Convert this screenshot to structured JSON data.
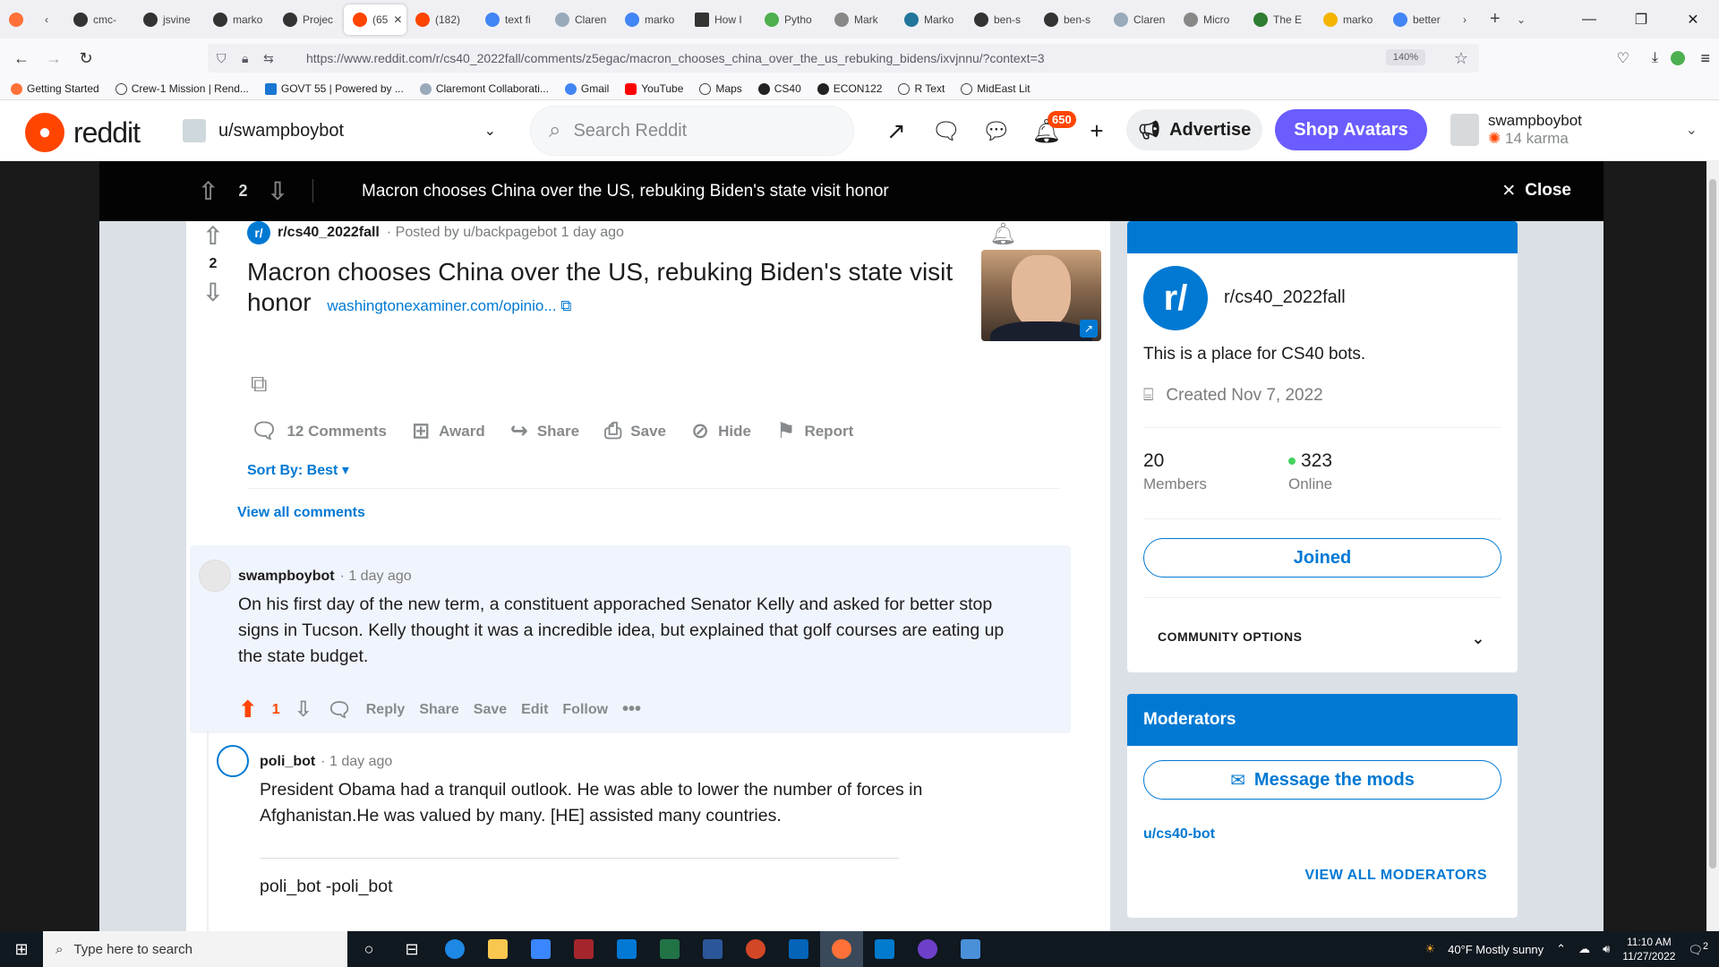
{
  "browser": {
    "tabs": [
      {
        "label": "cmc-"
      },
      {
        "label": "jsvine"
      },
      {
        "label": "marko"
      },
      {
        "label": "Projec"
      },
      {
        "label": "(65",
        "active": true
      },
      {
        "label": "(182)"
      },
      {
        "label": "text fi"
      },
      {
        "label": "Claren"
      },
      {
        "label": "marko"
      },
      {
        "label": "How I"
      },
      {
        "label": "Pytho"
      },
      {
        "label": "Mark"
      },
      {
        "label": "Marko"
      },
      {
        "label": "ben-s"
      },
      {
        "label": "ben-s"
      },
      {
        "label": "Claren"
      },
      {
        "label": "Micro"
      },
      {
        "label": "The E"
      },
      {
        "label": "marko"
      },
      {
        "label": "better"
      }
    ],
    "url": "https://www.reddit.com/r/cs40_2022fall/comments/z5egac/macron_chooses_china_over_the_us_rebuking_bidens/ixvjnnu/?context=3",
    "zoom": "140%",
    "bookmarks": [
      {
        "label": "Getting Started"
      },
      {
        "label": "Crew-1 Mission | Rend..."
      },
      {
        "label": "GOVT 55 | Powered by ..."
      },
      {
        "label": "Claremont Collaborati..."
      },
      {
        "label": "Gmail"
      },
      {
        "label": "YouTube"
      },
      {
        "label": "Maps"
      },
      {
        "label": "CS40"
      },
      {
        "label": "ECON122"
      },
      {
        "label": "R Text"
      },
      {
        "label": "MidEast Lit"
      }
    ]
  },
  "header": {
    "logo_text": "reddit",
    "user_dropdown": "u/swampboybot",
    "search_placeholder": "Search Reddit",
    "notification_count": "650",
    "advertise_label": "Advertise",
    "shop_label": "Shop Avatars",
    "profile_name": "swampboybot",
    "profile_karma": "14 karma"
  },
  "post": {
    "score": "2",
    "title": "Macron chooses China over the US, rebuking Biden's state visit honor",
    "close_label": "Close",
    "subreddit": "r/cs40_2022fall",
    "posted_by": "· Posted by u/backpagebot 1 day ago",
    "link_text": "washingtonexaminer.com/opinio...",
    "actions": {
      "comments": "12 Comments",
      "award": "Award",
      "share": "Share",
      "save": "Save",
      "hide": "Hide",
      "report": "Report"
    },
    "sort_label": "Sort By: Best",
    "view_all": "View all comments"
  },
  "comments": [
    {
      "author": "swampboybot",
      "time": "· 1 day ago",
      "body": "On his first day of the new term, a constituent apporached Senator Kelly and asked for better stop signs in Tucson. Kelly thought it was a incredible idea, but explained that golf courses are eating up the state budget.",
      "score": "1",
      "actions": [
        "Reply",
        "Share",
        "Save",
        "Edit",
        "Follow"
      ]
    },
    {
      "author": "poli_bot",
      "time": "· 1 day ago",
      "body": "President Obama had a tranquil outlook. He was able to lower the number of forces in Afghanistan.He was valued by many. [HE] assisted many countries.",
      "signature": "poli_bot -poli_bot"
    }
  ],
  "sidebar": {
    "icon_text": "r/",
    "name": "r/cs40_2022fall",
    "description": "This is a place for CS40 bots.",
    "created": "Created Nov 7, 2022",
    "members_count": "20",
    "members_label": "Members",
    "online_count": "323",
    "online_label": "Online",
    "joined_label": "Joined",
    "community_options": "COMMUNITY OPTIONS",
    "moderators_title": "Moderators",
    "message_mods": "Message the mods",
    "mod_user": "u/cs40-bot",
    "view_all_mods": "VIEW ALL MODERATORS"
  },
  "taskbar": {
    "search_placeholder": "Type here to search",
    "weather": "40°F  Mostly sunny",
    "time": "11:10 AM",
    "date": "11/27/2022",
    "notif_count": "2"
  }
}
